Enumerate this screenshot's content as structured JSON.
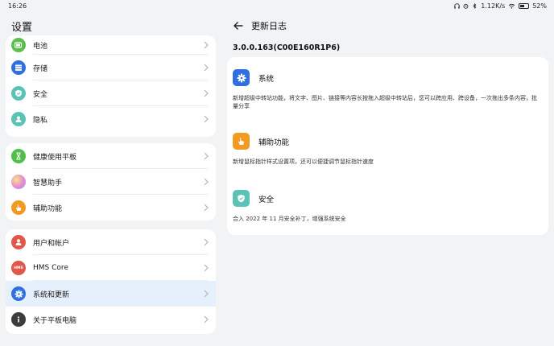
{
  "status_bar": {
    "time": "16:26",
    "net_speed": "1.12K/s",
    "battery": "52%",
    "battery_level": 0.52
  },
  "settings": {
    "title": "设置",
    "groups": [
      {
        "items": [
          {
            "label": "电池",
            "icon": "battery-icon",
            "color": "#5bbf4e"
          },
          {
            "label": "存储",
            "icon": "storage-icon",
            "color": "#2f6fe0"
          },
          {
            "label": "安全",
            "icon": "shield-icon",
            "color": "#5ac3b5"
          },
          {
            "label": "隐私",
            "icon": "privacy-icon",
            "color": "#5ac3b5"
          }
        ]
      },
      {
        "items": [
          {
            "label": "健康使用平板",
            "icon": "hourglass-icon",
            "color": "#4fbf4a"
          },
          {
            "label": "智慧助手",
            "icon": "assistant-icon",
            "color": "#d08ad8"
          },
          {
            "label": "辅助功能",
            "icon": "hand-icon",
            "color": "#f29a22"
          }
        ]
      },
      {
        "items": [
          {
            "label": "用户和帐户",
            "icon": "user-icon",
            "color": "#e2574c"
          },
          {
            "label": "HMS Core",
            "icon": "hms-icon",
            "color": "#e0574c",
            "icon_text": "HMS"
          },
          {
            "label": "系统和更新",
            "icon": "gear-icon",
            "color": "#2f6fe0",
            "selected": true
          },
          {
            "label": "关于平板电脑",
            "icon": "info-icon",
            "color": "#3c3c3c"
          }
        ]
      }
    ]
  },
  "changelog": {
    "title": "更新日志",
    "version": "3.0.0.163(C00E160R1P6)",
    "sections": [
      {
        "title": "系统",
        "icon": "system-gear-icon",
        "color": "#2f6fe0",
        "description": "新增超级中转站功能，将文字、图片、链接等内容长按拖入超级中转站后，您可以跨应用、跨设备，一次拖出多条内容，批量分享"
      },
      {
        "title": "辅助功能",
        "icon": "hand-icon",
        "color": "#f29a22",
        "description": "新增鼠标指针样式设置项，还可以便捷调节鼠标指针速度"
      },
      {
        "title": "安全",
        "icon": "shield-icon",
        "color": "#5ac3b5",
        "description": "合入 2022 年 11 月安全补丁，增强系统安全"
      }
    ]
  }
}
